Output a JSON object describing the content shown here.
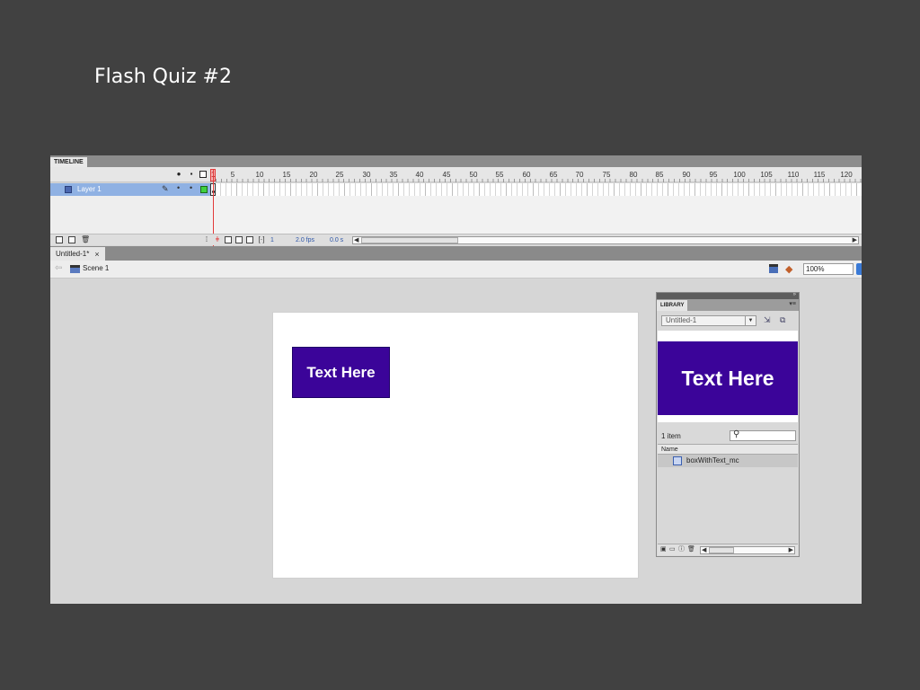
{
  "slide": {
    "title": "Flash Quiz #2"
  },
  "timeline": {
    "tab_label": "TIMELINE",
    "ruler": [
      "1",
      "5",
      "10",
      "15",
      "20",
      "25",
      "30",
      "35",
      "40",
      "45",
      "50",
      "55",
      "60",
      "65",
      "70",
      "75",
      "80",
      "85",
      "90",
      "95",
      "100",
      "105",
      "110",
      "115",
      "120"
    ],
    "layer": {
      "name": "Layer 1"
    },
    "footer": {
      "current_frame": "1",
      "fps": "2.0 fps",
      "time": "0.0 s"
    }
  },
  "document": {
    "tab_label": "Untitled-1*",
    "scene_label": "Scene 1",
    "zoom": "100%"
  },
  "stage": {
    "box_text": "Text Here"
  },
  "library": {
    "tab_label": "LIBRARY",
    "document_select": "Untitled-1",
    "preview_text": "Text Here",
    "item_count": "1 item",
    "column_header": "Name",
    "items": [
      {
        "name": "boxWithText_mc"
      }
    ]
  },
  "colors": {
    "background": "#414141",
    "symbol_fill": "#3b0499",
    "layer_highlight": "#8fb1e3",
    "playhead": "#e23a3a"
  }
}
